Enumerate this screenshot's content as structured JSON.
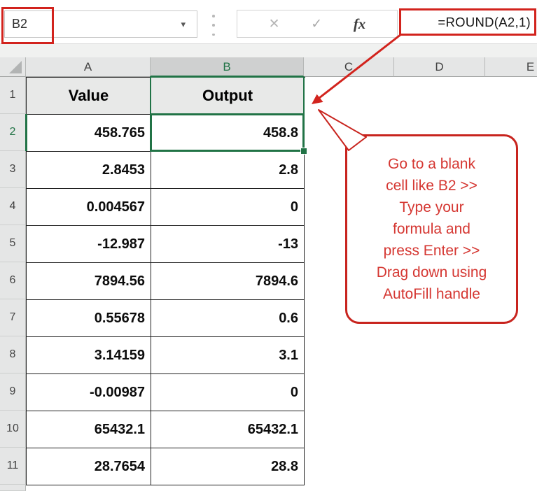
{
  "name_box": {
    "value": "B2"
  },
  "formula_bar": {
    "formula": "=ROUND(A2,1)",
    "fx_label": "fx",
    "cancel_icon": "✕",
    "enter_icon": "✓",
    "dropdown_icon": "▾"
  },
  "column_headers": [
    "A",
    "B",
    "C",
    "D",
    "E"
  ],
  "row_numbers": [
    "1",
    "2",
    "3",
    "4",
    "5",
    "6",
    "7",
    "8",
    "9",
    "10",
    "11"
  ],
  "selection": {
    "active_cell": "B2",
    "selected_column": "B",
    "selected_row": "2"
  },
  "table": {
    "column_titles": {
      "value": "Value",
      "output": "Output"
    },
    "rows": [
      {
        "row": "2",
        "value": "458.765",
        "output": "458.8"
      },
      {
        "row": "3",
        "value": "2.8453",
        "output": "2.8"
      },
      {
        "row": "4",
        "value": "0.004567",
        "output": "0"
      },
      {
        "row": "5",
        "value": "-12.987",
        "output": "-13"
      },
      {
        "row": "6",
        "value": "7894.56",
        "output": "7894.6"
      },
      {
        "row": "7",
        "value": "0.55678",
        "output": "0.6"
      },
      {
        "row": "8",
        "value": "3.14159",
        "output": "3.1"
      },
      {
        "row": "9",
        "value": "-0.00987",
        "output": "0"
      },
      {
        "row": "10",
        "value": "65432.1",
        "output": "65432.1"
      },
      {
        "row": "11",
        "value": "28.7654",
        "output": "28.8"
      }
    ]
  },
  "callout": {
    "lines": [
      "Go to a blank",
      "cell like B2 >>",
      "Type your",
      "formula and",
      "press Enter >>",
      "Drag down using",
      "AutoFill handle"
    ]
  },
  "colors": {
    "excel_green": "#217346",
    "annotation_red": "#d2231d",
    "callout_text_red": "#d53732"
  }
}
